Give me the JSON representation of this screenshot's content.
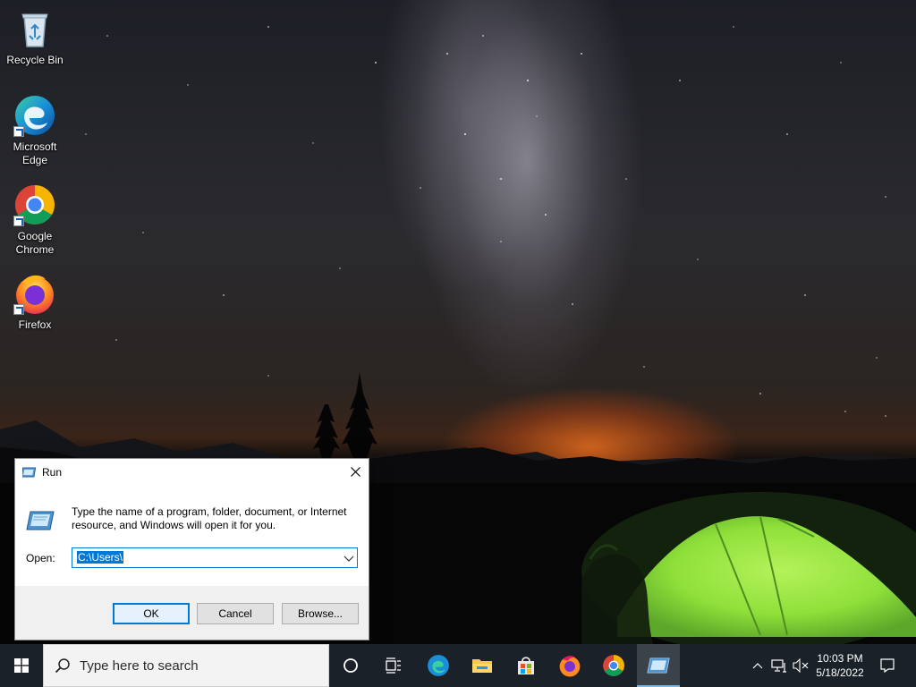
{
  "desktop": {
    "icons": [
      {
        "label": "Recycle Bin",
        "icon": "recycle-bin-icon"
      },
      {
        "label": "Microsoft Edge",
        "icon": "edge-icon"
      },
      {
        "label": "Google Chrome",
        "icon": "chrome-icon"
      },
      {
        "label": "Firefox",
        "icon": "firefox-icon"
      }
    ]
  },
  "run_dialog": {
    "title": "Run",
    "description": "Type the name of a program, folder, document, or Internet resource, and Windows will open it for you.",
    "open_label": "Open:",
    "open_value": "C:\\Users\\",
    "ok_label": "OK",
    "cancel_label": "Cancel",
    "browse_label": "Browse..."
  },
  "taskbar": {
    "search_placeholder": "Type here to search",
    "pinned": [
      "cortana-icon",
      "task-view-icon",
      "edge-icon",
      "file-explorer-icon",
      "store-icon",
      "firefox-icon",
      "chrome-icon",
      "run-icon"
    ],
    "time": "10:03 PM",
    "date": "5/18/2022"
  },
  "colors": {
    "accent": "#0078d7",
    "taskbar": "#1b2128",
    "tent_green": "#8fe03a",
    "horizon_glow": "#e86e1e"
  }
}
